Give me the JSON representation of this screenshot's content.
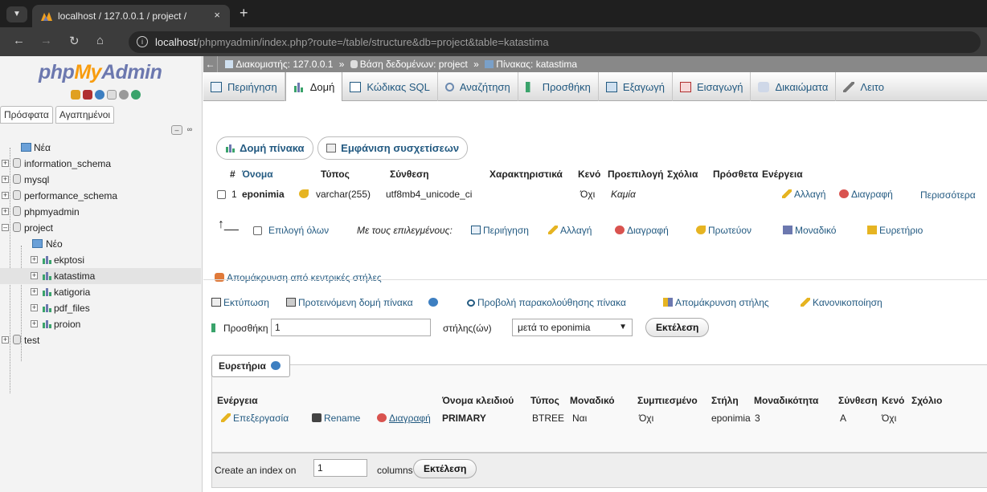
{
  "browser": {
    "tab_title": "localhost / 127.0.0.1 / project /",
    "tab_close": "×",
    "new_tab": "+",
    "url_host": "localhost",
    "url_rest": "/phpmyadmin/index.php?route=/table/structure&db=project&table=katastima"
  },
  "nav": {
    "logo_php": "php",
    "logo_my": "My",
    "logo_admin": "Admin",
    "tabs": [
      "Πρόσφατα",
      "Αγαπημένοι"
    ],
    "tree": {
      "new": "Νέα",
      "dbs": [
        "information_schema",
        "mysql",
        "performance_schema",
        "phpmyadmin",
        "project"
      ],
      "project_new": "Νέο",
      "tables": [
        "ekptosi",
        "katastima",
        "katigoria",
        "pdf_files",
        "proion"
      ],
      "last_db": "test"
    }
  },
  "breadcrumb": {
    "server": "Διακομιστής: 127.0.0.1",
    "db": "Βάση δεδομένων: project",
    "table": "Πίνακας: katastima",
    "sep": "»"
  },
  "menu": [
    "Περιήγηση",
    "Δομή",
    "Κώδικας SQL",
    "Αναζήτηση",
    "Προσθήκη",
    "Εξαγωγή",
    "Εισαγωγή",
    "Δικαιώματα",
    "Λειτο"
  ],
  "subtabs": [
    "Δομή πίνακα",
    "Εμφάνιση συσχετίσεων"
  ],
  "structure": {
    "headers": [
      "#",
      "Όνομα",
      "Τύπος",
      "Σύνθεση",
      "Χαρακτηριστικά",
      "Κενό",
      "Προεπιλογή",
      "Σχόλια",
      "Πρόσθετα",
      "Ενέργεια"
    ],
    "row": {
      "num": "1",
      "name": "eponimia",
      "type": "varchar(255)",
      "collation": "utf8mb4_unicode_ci",
      "null": "Όχι",
      "default": "Καμία",
      "action_change": "Αλλαγή",
      "action_drop": "Διαγραφή",
      "action_more": "Περισσότερα"
    },
    "with_selected": {
      "check_all": "Επιλογή όλων",
      "label": "Με τους επιλεγμένους:",
      "browse": "Περιήγηση",
      "change": "Αλλαγή",
      "drop": "Διαγραφή",
      "primary": "Πρωτεύον",
      "unique": "Μοναδικό",
      "index": "Ευρετήριο",
      "remove_central": "Απομάκρυνση από κεντρικές στήλες"
    }
  },
  "tools": {
    "print": "Εκτύπωση",
    "propose": "Προτεινόμενη δομή πίνακα",
    "track": "Προβολή παρακολούθησης πίνακα",
    "move": "Απομάκρυνση στήλης",
    "normalize": "Κανονικοποίηση",
    "add_label": "Προσθήκη",
    "add_value": "1",
    "columns_label": "στήλης(ών)",
    "after_option": "μετά το eponimia",
    "go": "Εκτέλεση"
  },
  "indexes": {
    "legend": "Ευρετήρια",
    "headers": [
      "Ενέργεια",
      "Όνομα κλειδιού",
      "Τύπος",
      "Μοναδικό",
      "Συμπιεσμένο",
      "Στήλη",
      "Μοναδικότητα",
      "Σύνθεση",
      "Κενό",
      "Σχόλιο"
    ],
    "row": {
      "edit": "Επεξεργασία",
      "rename": "Rename",
      "drop": "Διαγραφή",
      "key": "PRIMARY",
      "type": "BTREE",
      "unique": "Ναι",
      "packed": "Όχι",
      "column": "eponimia",
      "cardinality": "3",
      "collation": "A",
      "null": "Όχι"
    },
    "create_label": "Create an index on",
    "create_value": "1",
    "columns_label": "columns",
    "go": "Εκτέλεση"
  },
  "colors": {
    "link": "#235a81",
    "logo_blue": "#6c78af",
    "logo_orange": "#f89c0e",
    "drop_red": "#d9534f"
  }
}
